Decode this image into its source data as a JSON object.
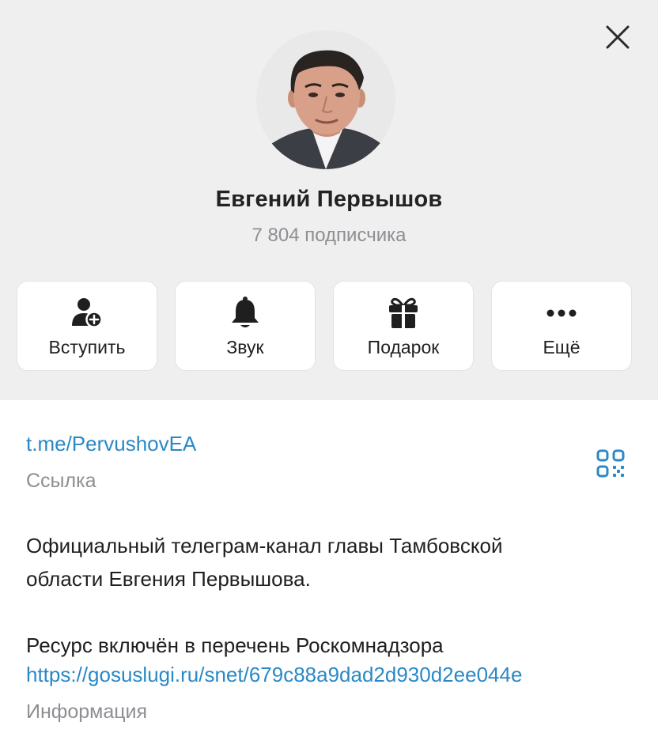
{
  "profile": {
    "name": "Евгений Первышов",
    "subscribers": "7 804 подписчика"
  },
  "actions": [
    {
      "label": "Вступить",
      "icon": "user-add-icon"
    },
    {
      "label": "Звук",
      "icon": "bell-icon"
    },
    {
      "label": "Подарок",
      "icon": "gift-icon"
    },
    {
      "label": "Ещё",
      "icon": "more-dots-icon"
    }
  ],
  "info": {
    "link": "t.me/PervushovEA",
    "link_caption": "Ссылка",
    "description_line1": "Официальный телеграм-канал главы Тамбовской",
    "description_line2": "области Евгения Первышова.",
    "registry_text": "Ресурс включён в перечень Роскомнадзора",
    "registry_link": "https://gosuslugi.ru/snet/679c88a9dad2d930d2ee044e",
    "info_caption": "Информация"
  },
  "colors": {
    "header_bg": "#efeff0",
    "link": "#2a88c6",
    "muted": "#8e8e93",
    "text": "#1f1f1f"
  }
}
